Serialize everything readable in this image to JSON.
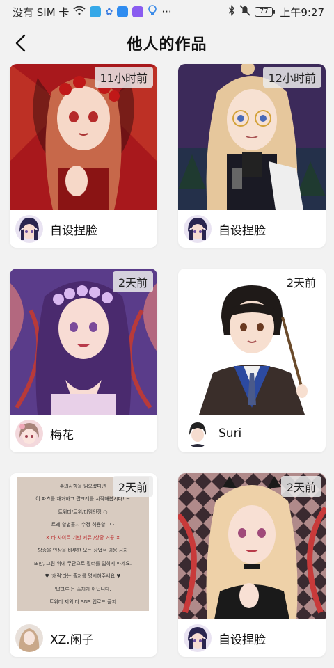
{
  "status_bar": {
    "carrier": "没有 SIM 卡",
    "battery": "77",
    "time": "上午9:27",
    "more": "···"
  },
  "header": {
    "title": "他人的作品"
  },
  "works": [
    {
      "time": "11小时前",
      "user": "自设捏脸"
    },
    {
      "time": "12小时前",
      "user": "自设捏脸"
    },
    {
      "time": "2天前",
      "user": "梅花"
    },
    {
      "time": "2天前",
      "user": "Suri"
    },
    {
      "time": "2天前",
      "user": "XZ.闲子"
    },
    {
      "time": "2天前",
      "user": "自设捏脸"
    }
  ],
  "notice_text": [
    "주의사항을 읽으셨다면",
    "이 파츠를 채거하고 팝크레를 시작해봅시다! ~",
    "트위터/트위/터맘인장 ○",
    "트레 합법홀시 수정 허용합니다",
    "✕ 타 사이트 기반 커뮤 /상황 거공 ✕",
    "방송을 인장을 비롯한 모든 상업적 이용 금지",
    "또한, 그림 위에 무단으로 필터를 입히지 마세요.",
    "♥ '캐릭'라는 출처를 명시해주세요 ♥",
    "'팝크루'는 출처가 아닙니다.",
    "트위터 제외 타 SNS 업로드 금지"
  ]
}
